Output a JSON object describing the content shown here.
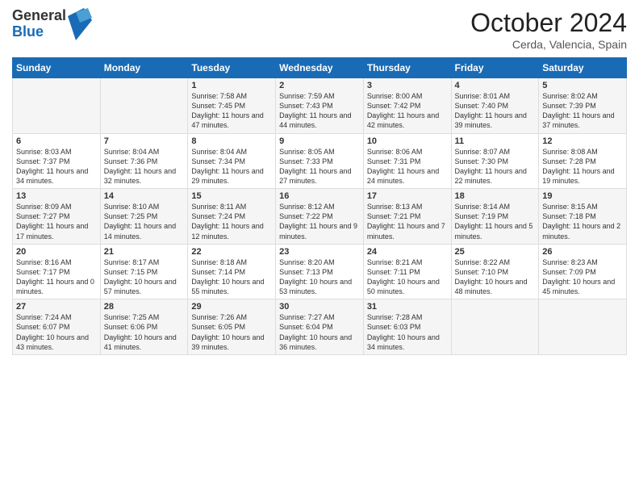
{
  "header": {
    "logo_general": "General",
    "logo_blue": "Blue",
    "title": "October 2024",
    "subtitle": "Cerda, Valencia, Spain"
  },
  "days_of_week": [
    "Sunday",
    "Monday",
    "Tuesday",
    "Wednesday",
    "Thursday",
    "Friday",
    "Saturday"
  ],
  "weeks": [
    [
      {
        "day": "",
        "info": ""
      },
      {
        "day": "",
        "info": ""
      },
      {
        "day": "1",
        "info": "Sunrise: 7:58 AM\nSunset: 7:45 PM\nDaylight: 11 hours and 47 minutes."
      },
      {
        "day": "2",
        "info": "Sunrise: 7:59 AM\nSunset: 7:43 PM\nDaylight: 11 hours and 44 minutes."
      },
      {
        "day": "3",
        "info": "Sunrise: 8:00 AM\nSunset: 7:42 PM\nDaylight: 11 hours and 42 minutes."
      },
      {
        "day": "4",
        "info": "Sunrise: 8:01 AM\nSunset: 7:40 PM\nDaylight: 11 hours and 39 minutes."
      },
      {
        "day": "5",
        "info": "Sunrise: 8:02 AM\nSunset: 7:39 PM\nDaylight: 11 hours and 37 minutes."
      }
    ],
    [
      {
        "day": "6",
        "info": "Sunrise: 8:03 AM\nSunset: 7:37 PM\nDaylight: 11 hours and 34 minutes."
      },
      {
        "day": "7",
        "info": "Sunrise: 8:04 AM\nSunset: 7:36 PM\nDaylight: 11 hours and 32 minutes."
      },
      {
        "day": "8",
        "info": "Sunrise: 8:04 AM\nSunset: 7:34 PM\nDaylight: 11 hours and 29 minutes."
      },
      {
        "day": "9",
        "info": "Sunrise: 8:05 AM\nSunset: 7:33 PM\nDaylight: 11 hours and 27 minutes."
      },
      {
        "day": "10",
        "info": "Sunrise: 8:06 AM\nSunset: 7:31 PM\nDaylight: 11 hours and 24 minutes."
      },
      {
        "day": "11",
        "info": "Sunrise: 8:07 AM\nSunset: 7:30 PM\nDaylight: 11 hours and 22 minutes."
      },
      {
        "day": "12",
        "info": "Sunrise: 8:08 AM\nSunset: 7:28 PM\nDaylight: 11 hours and 19 minutes."
      }
    ],
    [
      {
        "day": "13",
        "info": "Sunrise: 8:09 AM\nSunset: 7:27 PM\nDaylight: 11 hours and 17 minutes."
      },
      {
        "day": "14",
        "info": "Sunrise: 8:10 AM\nSunset: 7:25 PM\nDaylight: 11 hours and 14 minutes."
      },
      {
        "day": "15",
        "info": "Sunrise: 8:11 AM\nSunset: 7:24 PM\nDaylight: 11 hours and 12 minutes."
      },
      {
        "day": "16",
        "info": "Sunrise: 8:12 AM\nSunset: 7:22 PM\nDaylight: 11 hours and 9 minutes."
      },
      {
        "day": "17",
        "info": "Sunrise: 8:13 AM\nSunset: 7:21 PM\nDaylight: 11 hours and 7 minutes."
      },
      {
        "day": "18",
        "info": "Sunrise: 8:14 AM\nSunset: 7:19 PM\nDaylight: 11 hours and 5 minutes."
      },
      {
        "day": "19",
        "info": "Sunrise: 8:15 AM\nSunset: 7:18 PM\nDaylight: 11 hours and 2 minutes."
      }
    ],
    [
      {
        "day": "20",
        "info": "Sunrise: 8:16 AM\nSunset: 7:17 PM\nDaylight: 11 hours and 0 minutes."
      },
      {
        "day": "21",
        "info": "Sunrise: 8:17 AM\nSunset: 7:15 PM\nDaylight: 10 hours and 57 minutes."
      },
      {
        "day": "22",
        "info": "Sunrise: 8:18 AM\nSunset: 7:14 PM\nDaylight: 10 hours and 55 minutes."
      },
      {
        "day": "23",
        "info": "Sunrise: 8:20 AM\nSunset: 7:13 PM\nDaylight: 10 hours and 53 minutes."
      },
      {
        "day": "24",
        "info": "Sunrise: 8:21 AM\nSunset: 7:11 PM\nDaylight: 10 hours and 50 minutes."
      },
      {
        "day": "25",
        "info": "Sunrise: 8:22 AM\nSunset: 7:10 PM\nDaylight: 10 hours and 48 minutes."
      },
      {
        "day": "26",
        "info": "Sunrise: 8:23 AM\nSunset: 7:09 PM\nDaylight: 10 hours and 45 minutes."
      }
    ],
    [
      {
        "day": "27",
        "info": "Sunrise: 7:24 AM\nSunset: 6:07 PM\nDaylight: 10 hours and 43 minutes."
      },
      {
        "day": "28",
        "info": "Sunrise: 7:25 AM\nSunset: 6:06 PM\nDaylight: 10 hours and 41 minutes."
      },
      {
        "day": "29",
        "info": "Sunrise: 7:26 AM\nSunset: 6:05 PM\nDaylight: 10 hours and 39 minutes."
      },
      {
        "day": "30",
        "info": "Sunrise: 7:27 AM\nSunset: 6:04 PM\nDaylight: 10 hours and 36 minutes."
      },
      {
        "day": "31",
        "info": "Sunrise: 7:28 AM\nSunset: 6:03 PM\nDaylight: 10 hours and 34 minutes."
      },
      {
        "day": "",
        "info": ""
      },
      {
        "day": "",
        "info": ""
      }
    ]
  ]
}
